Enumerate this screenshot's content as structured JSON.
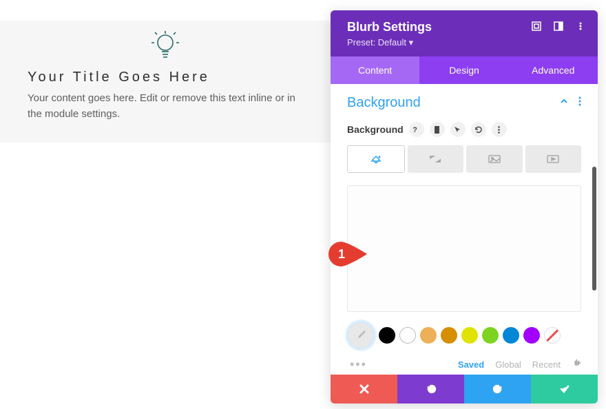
{
  "content": {
    "title": "Your Title Goes Here",
    "body": "Your content goes here. Edit or remove this text inline or in the module settings."
  },
  "panel": {
    "title": "Blurb Settings",
    "preset": "Preset: Default ▾"
  },
  "tabs": {
    "content": "Content",
    "design": "Design",
    "advanced": "Advanced"
  },
  "section": {
    "title": "Background",
    "label": "Background"
  },
  "swatches": {
    "colors": [
      "#000000",
      "#ffffff",
      "#edb059",
      "#d58f00",
      "#e0e300",
      "#7ed321",
      "#0087d6",
      "#a100ff"
    ]
  },
  "states": {
    "saved": "Saved",
    "global": "Global",
    "recent": "Recent"
  },
  "annotation": {
    "number": "1"
  }
}
